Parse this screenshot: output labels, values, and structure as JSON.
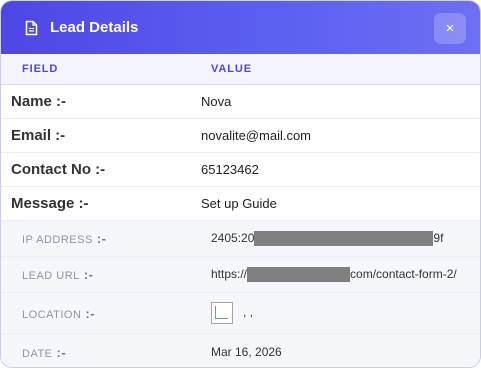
{
  "header": {
    "title": "Lead Details",
    "icon": "document-icon",
    "close_icon": "×",
    "gradient_colors": [
      "#4f46e5",
      "#6d6ff3"
    ]
  },
  "columns": {
    "field": "FIELD",
    "value": "VALUE"
  },
  "fields": {
    "name": {
      "label": "Name :-",
      "value": "Nova"
    },
    "email": {
      "label": "Email :-",
      "value": "novalite@mail.com"
    },
    "contact": {
      "label": "Contact No :-",
      "value": "65123462"
    },
    "message": {
      "label": "Message :-",
      "value": "Set up Guide"
    }
  },
  "meta": {
    "separator": ":-",
    "ip": {
      "label": "IP ADDRESS",
      "prefix": "2405:20",
      "suffix": "9f"
    },
    "url": {
      "label": "LEAD URL",
      "prefix": "https://",
      "suffix": "com/contact-form-2/"
    },
    "location": {
      "label": "LOCATION",
      "value": ", ,"
    },
    "date": {
      "label": "DATE",
      "value": "Mar 16, 2026"
    }
  },
  "colors": {
    "accent": "#4f46e5",
    "link": "#2f36c9",
    "redaction": "#808080"
  }
}
